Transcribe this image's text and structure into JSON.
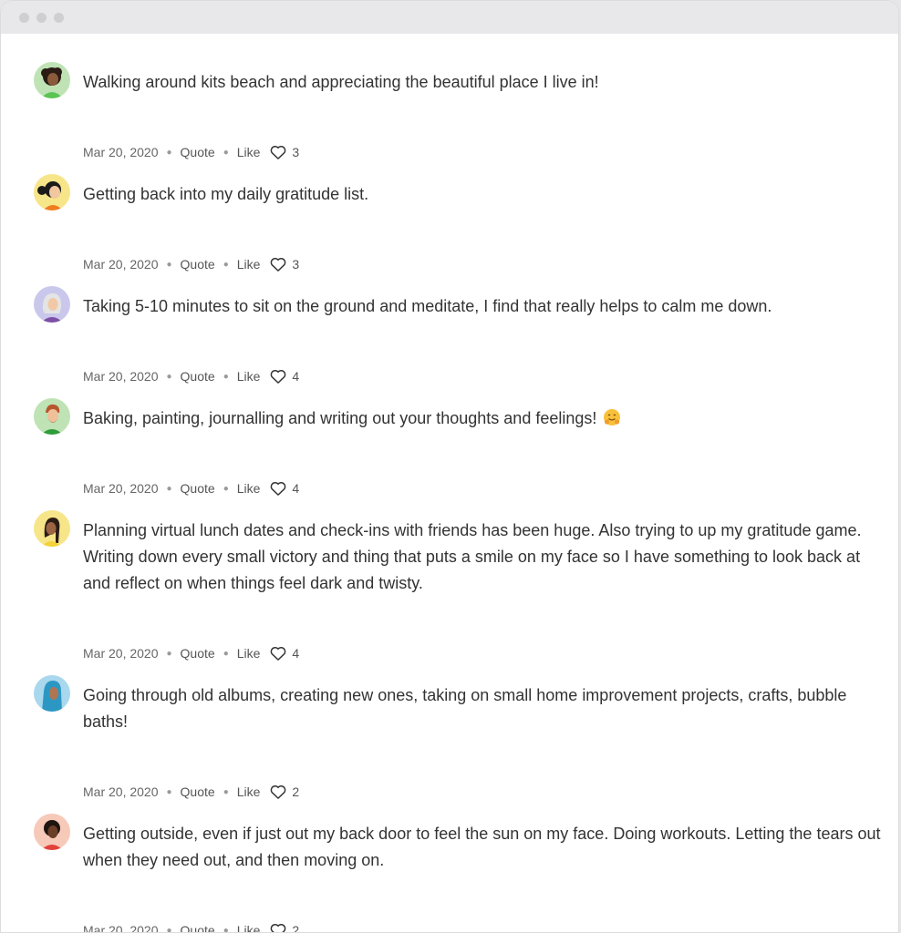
{
  "window": {
    "controls": [
      "close",
      "minimize",
      "maximize"
    ]
  },
  "actions": {
    "quote_label": "Quote",
    "like_label": "Like"
  },
  "posts": [
    {
      "avatar": "avatar-green-woman-curly-hair",
      "text": "Walking around kits beach and appreciating the beautiful place I live in!",
      "date": "Mar 20, 2020",
      "likes": "3"
    },
    {
      "avatar": "avatar-yellow-woman-ponytail",
      "text": "Getting back into my daily gratitude list.",
      "date": "Mar 20, 2020",
      "likes": "3"
    },
    {
      "avatar": "avatar-lavender-older-woman",
      "text": "Taking 5-10 minutes to sit on the ground and meditate, I find that really helps to calm me down.",
      "date": "Mar 20, 2020",
      "likes": "4"
    },
    {
      "avatar": "avatar-green-bearded-man",
      "text": "Baking, painting, journalling and writing out your thoughts and feelings!",
      "emoji": "hugging-face-emoji",
      "date": "Mar 20, 2020",
      "likes": "4"
    },
    {
      "avatar": "avatar-yellow-woman-braid",
      "text": "Planning virtual lunch dates and check-ins with friends has been huge. Also trying to up my gratitude game. Writing down every small victory and thing that puts a smile on my face so I have something to look back at and reflect on when things feel dark and twisty.",
      "date": "Mar 20, 2020",
      "likes": "4"
    },
    {
      "avatar": "avatar-blue-woman-hijab",
      "text": "Going through old albums, creating new ones, taking on small home improvement projects, crafts, bubble baths!",
      "date": "Mar 20, 2020",
      "likes": "2"
    },
    {
      "avatar": "avatar-peach-woman-dark-hair",
      "text": "Getting outside, even if just out my back door to feel the sun on my face. Doing workouts. Letting the tears out when they need out, and then moving on.",
      "date": "Mar 20, 2020",
      "likes": "2"
    }
  ]
}
